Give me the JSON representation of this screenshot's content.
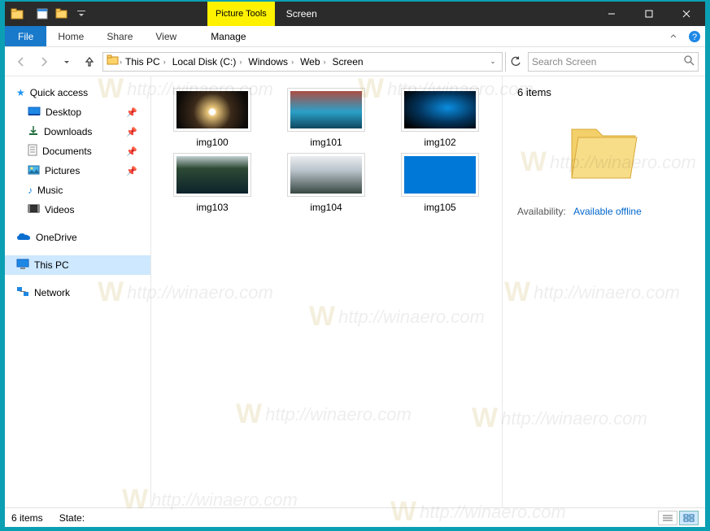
{
  "titlebar": {
    "context_tab_label": "Picture Tools",
    "window_title": "Screen"
  },
  "ribbon": {
    "file": "File",
    "tabs": [
      "Home",
      "Share",
      "View"
    ],
    "context_tab": "Manage"
  },
  "address": {
    "crumbs": [
      "This PC",
      "Local Disk (C:)",
      "Windows",
      "Web",
      "Screen"
    ],
    "search_placeholder": "Search Screen"
  },
  "nav": {
    "quick_access": "Quick access",
    "items": [
      {
        "label": "Desktop",
        "pinned": true
      },
      {
        "label": "Downloads",
        "pinned": true
      },
      {
        "label": "Documents",
        "pinned": true
      },
      {
        "label": "Pictures",
        "pinned": true
      },
      {
        "label": "Music",
        "pinned": false
      },
      {
        "label": "Videos",
        "pinned": false
      }
    ],
    "onedrive": "OneDrive",
    "this_pc": "This PC",
    "network": "Network"
  },
  "files": [
    {
      "name": "img100"
    },
    {
      "name": "img101"
    },
    {
      "name": "img102"
    },
    {
      "name": "img103"
    },
    {
      "name": "img104"
    },
    {
      "name": "img105"
    }
  ],
  "details": {
    "header": "6 items",
    "availability_label": "Availability:",
    "availability_value": "Available offline"
  },
  "statusbar": {
    "count": "6 items",
    "state_label": "State:"
  },
  "watermark": "http://winaero.com"
}
